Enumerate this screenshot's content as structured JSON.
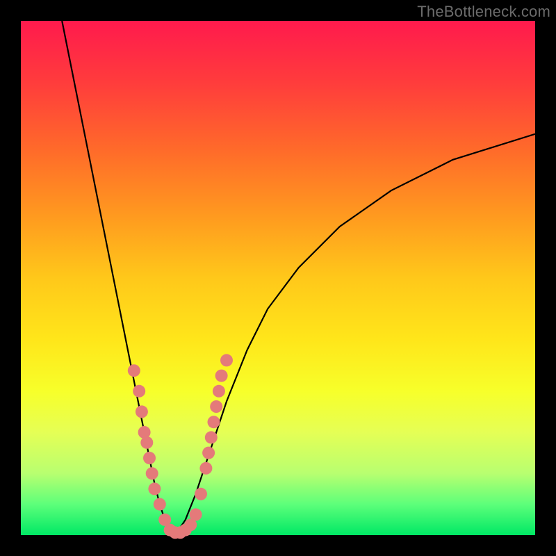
{
  "watermark": "TheBottleneck.com",
  "chart_data": {
    "type": "line",
    "title": "",
    "xlabel": "",
    "ylabel": "",
    "xlim": [
      0,
      100
    ],
    "ylim": [
      0,
      100
    ],
    "grid": false,
    "series": [
      {
        "name": "left-curve",
        "x": [
          8,
          10,
          12,
          14,
          16,
          18,
          20,
          22,
          24,
          26,
          27,
          28,
          29,
          30
        ],
        "y": [
          100,
          90,
          80,
          70,
          60,
          50,
          40,
          30,
          20,
          10,
          6,
          3,
          1,
          0
        ]
      },
      {
        "name": "right-curve",
        "x": [
          30,
          32,
          34,
          36,
          38,
          40,
          44,
          48,
          54,
          62,
          72,
          84,
          100
        ],
        "y": [
          0,
          3,
          8,
          14,
          20,
          26,
          36,
          44,
          52,
          60,
          67,
          73,
          78
        ]
      }
    ],
    "scatter": {
      "name": "dot-cluster",
      "color": "#e47a7a",
      "points": [
        {
          "x": 22,
          "y": 32
        },
        {
          "x": 23,
          "y": 28
        },
        {
          "x": 23.5,
          "y": 24
        },
        {
          "x": 24,
          "y": 20
        },
        {
          "x": 24.5,
          "y": 18
        },
        {
          "x": 25,
          "y": 15
        },
        {
          "x": 25.5,
          "y": 12
        },
        {
          "x": 26,
          "y": 9
        },
        {
          "x": 27,
          "y": 6
        },
        {
          "x": 28,
          "y": 3
        },
        {
          "x": 29,
          "y": 1
        },
        {
          "x": 30,
          "y": 0.5
        },
        {
          "x": 31,
          "y": 0.5
        },
        {
          "x": 32,
          "y": 1
        },
        {
          "x": 33,
          "y": 2
        },
        {
          "x": 34,
          "y": 4
        },
        {
          "x": 35,
          "y": 8
        },
        {
          "x": 36,
          "y": 13
        },
        {
          "x": 36.5,
          "y": 16
        },
        {
          "x": 37,
          "y": 19
        },
        {
          "x": 37.5,
          "y": 22
        },
        {
          "x": 38,
          "y": 25
        },
        {
          "x": 38.5,
          "y": 28
        },
        {
          "x": 39,
          "y": 31
        },
        {
          "x": 40,
          "y": 34
        }
      ]
    },
    "gradient_stops": [
      {
        "pos": 0,
        "color": "#ff1a4d"
      },
      {
        "pos": 50,
        "color": "#ffe61a"
      },
      {
        "pos": 100,
        "color": "#00e865"
      }
    ]
  }
}
